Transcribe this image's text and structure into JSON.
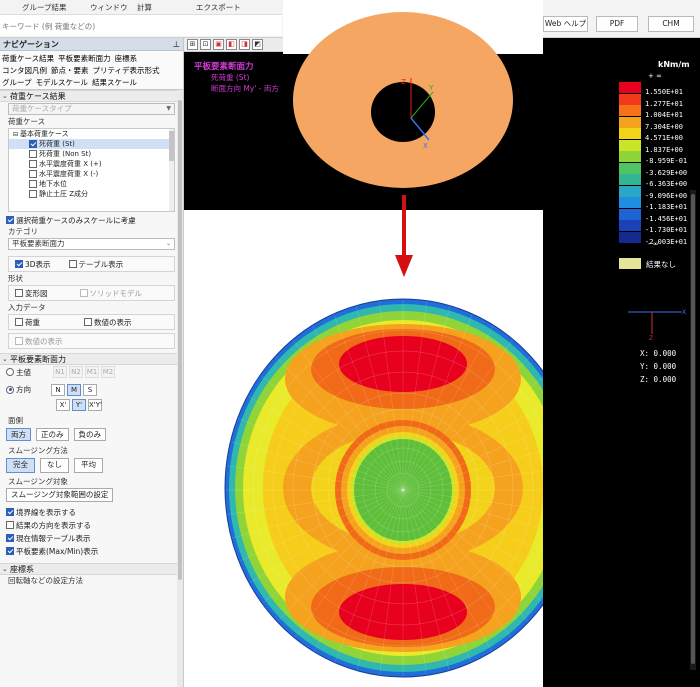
{
  "menu": {
    "group_result": "グループ結果",
    "window": "ウィンドウ",
    "calc": "計算",
    "export": "エクスポート"
  },
  "search": {
    "placeholder": "キーワード (例 荷重などの)"
  },
  "top_buttons": {
    "web_help": "Web ヘルプ",
    "pdf": "PDF",
    "chm": "CHM"
  },
  "nav": {
    "title": "ナビゲーション",
    "tabs_row1": [
      "荷重ケース結果",
      "平板要素断面力",
      "座標系"
    ],
    "tabs_row2": [
      "コンタ図凡例",
      "節点・要素",
      "プリティデ表示形式"
    ],
    "tabs_row3": [
      "グループ",
      "モデルスケール",
      "結果スケール"
    ],
    "load_case_result": {
      "header": "荷重ケース結果",
      "result_type": "荷重ケースタイプ",
      "load_case_label": "荷重ケース",
      "tree": [
        "基本荷重ケース",
        "死荷重 (St)",
        "死荷重 (Non St)",
        "水平震度荷重 X (+)",
        "水平震度荷重 X (-)",
        "地下水位",
        "静止土圧 Z成分"
      ],
      "same_scale": "選択荷重ケースのみスケールに考慮",
      "category_label": "カテゴリ",
      "category_value": "平板要素断面力",
      "show_3d": "3D表示",
      "show_table": "テーブル表示",
      "shape_label": "形状",
      "deformed": "変形図",
      "solid_model": "ソリッドモデル",
      "input_data_label": "入力データ",
      "load": "荷重",
      "value_display": "数値の表示",
      "value_display2": "数値の表示"
    },
    "plate_force": {
      "header": "平板要素断面力",
      "principal": "主値",
      "principal_btns": [
        "N1",
        "N2",
        "M1",
        "M2"
      ],
      "direction": "方向",
      "dir_btns_row1": [
        "N",
        "M",
        "S"
      ],
      "dir_btns_row2": [
        "X'",
        "Y'",
        "X'Y'"
      ],
      "surface_label": "面側",
      "surface_btns": [
        "両方",
        "正のみ",
        "負のみ"
      ],
      "smoothing_label": "スムージング方法",
      "smoothing_btns": [
        "完全",
        "なし",
        "平均"
      ],
      "smoothing_target_label": "スムージング対象",
      "smoothing_target_btn": "スムージング対象範囲の設定",
      "show_boundary": "境界線を表示する",
      "show_result_dir": "結果の方向を表示する",
      "show_info_table": "現在情報テーブル表示",
      "show_maxmin": "平板要素(Max/Min)表示"
    },
    "coord_sys": {
      "header": "座標系",
      "sub": "回転軸などの設定方法"
    }
  },
  "viewport": {
    "title": "平板要素断面力",
    "load_case": "死荷重 (St)",
    "direction": "断面方向 My' - 両方",
    "unit": "kNm/m",
    "legend_plus": "+ ∞",
    "legend_minus": "- ∞",
    "legend_values": [
      "1.550E+01",
      "1.277E+01",
      "1.004E+01",
      "7.304E+00",
      "4.571E+00",
      "1.837E+00",
      "-8.959E-01",
      "-3.629E+00",
      "-6.363E+00",
      "-9.096E+00",
      "-1.183E+01",
      "-1.456E+01",
      "-1.730E+01",
      "-2.003E+01"
    ],
    "legend_colors": [
      "#e8001f",
      "#f13a1a",
      "#f7701a",
      "#f5a31f",
      "#f3d21a",
      "#c9e52a",
      "#8fd53a",
      "#4fc462",
      "#31b592",
      "#29a7c4",
      "#1f8ee0",
      "#1e63d3",
      "#1a42b6",
      "#142a8e"
    ],
    "no_result": "結果なし",
    "coords": [
      "X: 0.000",
      "Y: 0.000",
      "Z: 0.000"
    ]
  }
}
